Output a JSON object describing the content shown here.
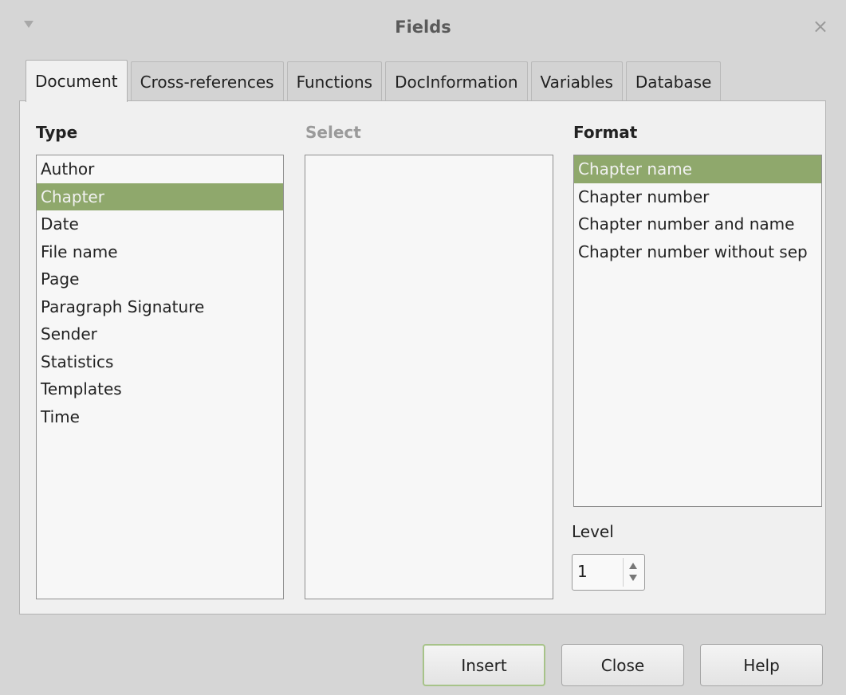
{
  "window": {
    "title": "Fields",
    "close_glyph": "×"
  },
  "tabs": [
    {
      "label": "Document",
      "active": true
    },
    {
      "label": "Cross-references",
      "active": false
    },
    {
      "label": "Functions",
      "active": false
    },
    {
      "label": "DocInformation",
      "active": false
    },
    {
      "label": "Variables",
      "active": false
    },
    {
      "label": "Database",
      "active": false
    }
  ],
  "type_column": {
    "heading": "Type",
    "items": [
      "Author",
      "Chapter",
      "Date",
      "File name",
      "Page",
      "Paragraph Signature",
      "Sender",
      "Statistics",
      "Templates",
      "Time"
    ],
    "selected": "Chapter"
  },
  "select_column": {
    "heading": "Select",
    "items": []
  },
  "format_column": {
    "heading": "Format",
    "items": [
      "Chapter name",
      "Chapter number",
      "Chapter number and name",
      "Chapter number without sep"
    ],
    "selected": "Chapter name"
  },
  "level": {
    "label": "Level",
    "value": "1"
  },
  "buttons": {
    "insert": "Insert",
    "close": "Close",
    "help": "Help"
  },
  "colors": {
    "selection": "#8fa86c",
    "default_button_border": "#a7c389"
  }
}
